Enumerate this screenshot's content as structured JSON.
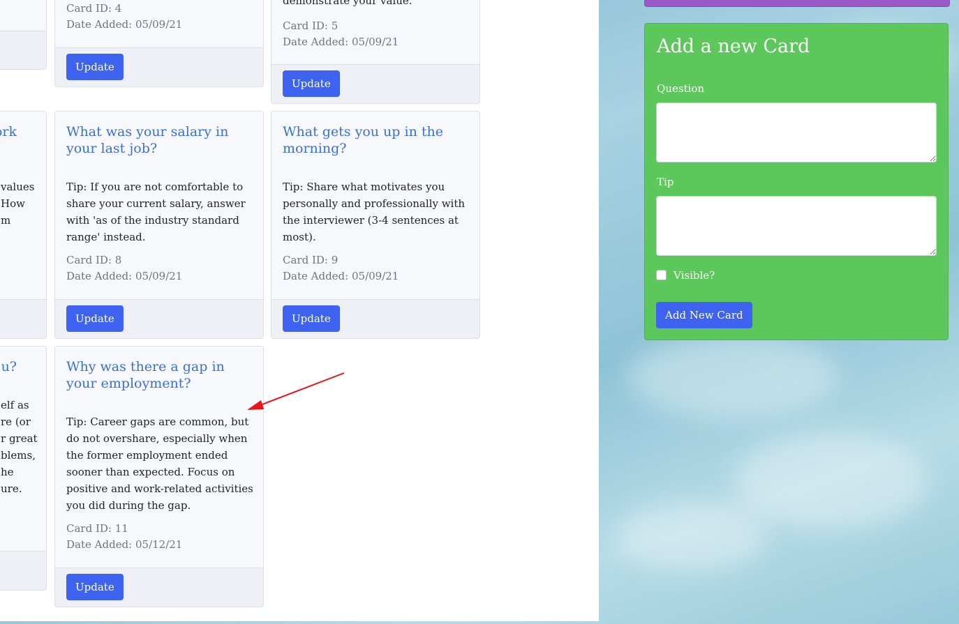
{
  "cards_partial_left": {
    "row2_title_fragment": "ork",
    "row2_tip_fragments": [
      "values",
      "How",
      "m"
    ],
    "row3_title_fragment": "u?",
    "row3_tip_fragments": [
      "elf as",
      "re (or",
      "r great",
      "blems,",
      "he",
      "ure."
    ]
  },
  "cards": [
    {
      "title": "",
      "tip": "",
      "tip_tail": "demonstrate your value.",
      "card_id": "Card ID: 5",
      "date_added": "Date Added: 05/09/21",
      "update_label": "Update"
    },
    {
      "title": "",
      "tip": "",
      "card_id": "Card ID: 4",
      "date_added": "Date Added: 05/09/21",
      "update_label": "Update"
    },
    {
      "title": "What was your salary in your last job?",
      "tip": "Tip: If you are not comfortable to share your current salary, answer with 'as of the industry standard range' instead.",
      "card_id": "Card ID: 8",
      "date_added": "Date Added: 05/09/21",
      "update_label": "Update"
    },
    {
      "title": "What gets you up in the morning?",
      "tip": "Tip: Share what motivates you personally and professionally with the interviewer (3-4 sentences at most).",
      "card_id": "Card ID: 9",
      "date_added": "Date Added: 05/09/21",
      "update_label": "Update"
    },
    {
      "title": "Why was there a gap in your employment?",
      "tip": "Tip: Career gaps are common, but do not overshare, especially when the former employment ended sooner than expected. Focus on positive and work-related activities you did during the gap.",
      "card_id": "Card ID: 11",
      "date_added": "Date Added: 05/12/21",
      "update_label": "Update"
    }
  ],
  "form": {
    "heading": "Add a new Card",
    "question_label": "Question",
    "tip_label": "Tip",
    "visible_label": "Visible?",
    "visible_checked": false,
    "submit_label": "Add New Card"
  },
  "colors": {
    "accent_button": "#3d63f0",
    "card_title": "#3a6fd6",
    "form_panel": "#5cc75a",
    "top_bar": "#9b59c8",
    "annotation_arrow": "#e8141b"
  }
}
